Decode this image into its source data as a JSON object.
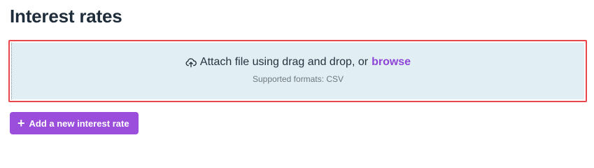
{
  "page": {
    "title": "Interest rates"
  },
  "upload": {
    "prompt": "Attach file using drag and drop, or",
    "browse_label": "browse",
    "formats_note": "Supported formats: CSV",
    "icon": "upload-cloud-icon"
  },
  "actions": {
    "add_label": "Add a new interest rate",
    "add_icon": "plus-icon"
  },
  "colors": {
    "accent": "#9b4ddb",
    "link": "#8e45d6",
    "highlight_border": "#e8474d",
    "dropzone_bg": "#e1eff5"
  }
}
